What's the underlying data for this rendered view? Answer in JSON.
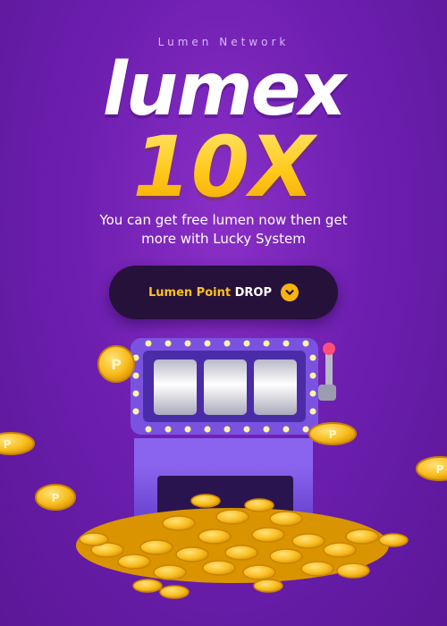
{
  "header": {
    "network_label": "Lumen Network",
    "brand": "lumex",
    "multiplier": "10X",
    "tagline": "You can get free lumen now then get more with Lucky System"
  },
  "drop_button": {
    "highlight": "Lumen Point",
    "word": "DROP",
    "icon": "chevron-down-icon"
  },
  "colors": {
    "background": "#6e1fb0",
    "accent_gold": "#ffc21a",
    "button_bg": "#26113a",
    "machine_purple": "#7a52e0"
  },
  "illustration": {
    "machine": "slot-machine",
    "coin_icon": "P"
  }
}
